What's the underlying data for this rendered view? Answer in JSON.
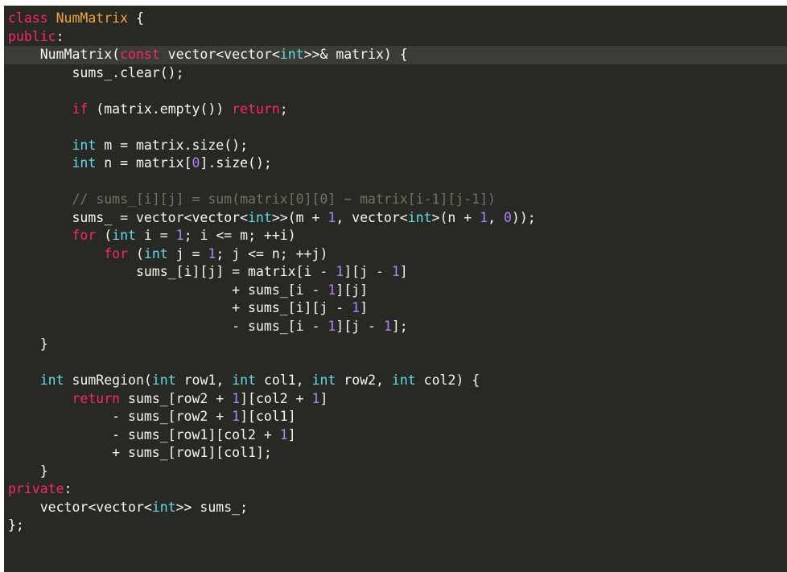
{
  "editor": {
    "language": "cpp",
    "theme": "monokai-dark",
    "background_color": "#282923",
    "highlight_line_color": "#3b3c36",
    "plain_text_color": "#f8f8f2",
    "keyword_color": "#f92672",
    "type_color": "#66d9ef",
    "class_name_color": "#f6a23b",
    "number_color": "#ae81ff",
    "comment_color": "#6f7266",
    "highlighted_line_number": 3,
    "total_lines": 31
  },
  "code": {
    "full_text": "class NumMatrix {\npublic:\n    NumMatrix(const vector<vector<int>>& matrix) {\n        sums_.clear();\n\n        if (matrix.empty()) return;\n\n        int m = matrix.size();\n        int n = matrix[0].size();\n\n        // sums_[i][j] = sum(matrix[0][0] ~ matrix[i-1][j-1])\n        sums_ = vector<vector<int>>(m + 1, vector<int>(n + 1, 0));\n        for (int i = 1; i <= m; ++i)\n            for (int j = 1; j <= n; ++j)\n                sums_[i][j] = matrix[i - 1][j - 1]\n                            + sums_[i - 1][j]\n                            + sums_[i][j - 1]\n                            - sums_[i - 1][j - 1];\n    }\n\n    int sumRegion(int row1, int col1, int row2, int col2) {\n        return sums_[row2 + 1][col2 + 1]\n             - sums_[row2 + 1][col1]\n             - sums_[row1][col2 + 1]\n             + sums_[row1][col1];\n    }\nprivate:\n    vector<vector<int>> sums_;\n};",
    "lines": [
      {
        "n": 1,
        "highlight": false,
        "tokens": [
          {
            "t": "class",
            "c": "kw"
          },
          {
            "t": " ",
            "c": "plain"
          },
          {
            "t": "NumMatrix",
            "c": "clsname"
          },
          {
            "t": " {",
            "c": "plain"
          }
        ]
      },
      {
        "n": 2,
        "highlight": false,
        "tokens": [
          {
            "t": "public",
            "c": "kw"
          },
          {
            "t": ":",
            "c": "plain"
          }
        ]
      },
      {
        "n": 3,
        "highlight": true,
        "tokens": [
          {
            "t": "    NumMatrix(",
            "c": "plain"
          },
          {
            "t": "const",
            "c": "kw"
          },
          {
            "t": " vector<vector<",
            "c": "plain"
          },
          {
            "t": "int",
            "c": "type"
          },
          {
            "t": ">>& matrix) {",
            "c": "plain"
          }
        ]
      },
      {
        "n": 4,
        "highlight": false,
        "tokens": [
          {
            "t": "        sums_.clear();",
            "c": "plain"
          }
        ]
      },
      {
        "n": 5,
        "highlight": false,
        "tokens": [
          {
            "t": "",
            "c": "plain"
          }
        ]
      },
      {
        "n": 6,
        "highlight": false,
        "tokens": [
          {
            "t": "        ",
            "c": "plain"
          },
          {
            "t": "if",
            "c": "kw"
          },
          {
            "t": " (matrix.empty()) ",
            "c": "plain"
          },
          {
            "t": "return",
            "c": "kw"
          },
          {
            "t": ";",
            "c": "plain"
          }
        ]
      },
      {
        "n": 7,
        "highlight": false,
        "tokens": [
          {
            "t": "",
            "c": "plain"
          }
        ]
      },
      {
        "n": 8,
        "highlight": false,
        "tokens": [
          {
            "t": "        ",
            "c": "plain"
          },
          {
            "t": "int",
            "c": "type"
          },
          {
            "t": " m = matrix.size();",
            "c": "plain"
          }
        ]
      },
      {
        "n": 9,
        "highlight": false,
        "tokens": [
          {
            "t": "        ",
            "c": "plain"
          },
          {
            "t": "int",
            "c": "type"
          },
          {
            "t": " n = matrix[",
            "c": "plain"
          },
          {
            "t": "0",
            "c": "num"
          },
          {
            "t": "].size();",
            "c": "plain"
          }
        ]
      },
      {
        "n": 10,
        "highlight": false,
        "tokens": [
          {
            "t": "",
            "c": "plain"
          }
        ]
      },
      {
        "n": 11,
        "highlight": false,
        "tokens": [
          {
            "t": "        ",
            "c": "plain"
          },
          {
            "t": "// sums_[i][j] = sum(matrix[0][0] ~ matrix[i-1][j-1])",
            "c": "comment"
          }
        ]
      },
      {
        "n": 12,
        "highlight": false,
        "tokens": [
          {
            "t": "        sums_ = vector<vector<",
            "c": "plain"
          },
          {
            "t": "int",
            "c": "type"
          },
          {
            "t": ">>(m + ",
            "c": "plain"
          },
          {
            "t": "1",
            "c": "num"
          },
          {
            "t": ", vector<",
            "c": "plain"
          },
          {
            "t": "int",
            "c": "type"
          },
          {
            "t": ">(n + ",
            "c": "plain"
          },
          {
            "t": "1",
            "c": "num"
          },
          {
            "t": ", ",
            "c": "plain"
          },
          {
            "t": "0",
            "c": "num"
          },
          {
            "t": "));",
            "c": "plain"
          }
        ]
      },
      {
        "n": 13,
        "highlight": false,
        "tokens": [
          {
            "t": "        ",
            "c": "plain"
          },
          {
            "t": "for",
            "c": "kw"
          },
          {
            "t": " (",
            "c": "plain"
          },
          {
            "t": "int",
            "c": "type"
          },
          {
            "t": " i = ",
            "c": "plain"
          },
          {
            "t": "1",
            "c": "num"
          },
          {
            "t": "; i <= m; ++i)",
            "c": "plain"
          }
        ]
      },
      {
        "n": 14,
        "highlight": false,
        "tokens": [
          {
            "t": "            ",
            "c": "plain"
          },
          {
            "t": "for",
            "c": "kw"
          },
          {
            "t": " (",
            "c": "plain"
          },
          {
            "t": "int",
            "c": "type"
          },
          {
            "t": " j = ",
            "c": "plain"
          },
          {
            "t": "1",
            "c": "num"
          },
          {
            "t": "; j <= n; ++j)",
            "c": "plain"
          }
        ]
      },
      {
        "n": 15,
        "highlight": false,
        "tokens": [
          {
            "t": "                sums_[i][j] = matrix[i - ",
            "c": "plain"
          },
          {
            "t": "1",
            "c": "num"
          },
          {
            "t": "][j - ",
            "c": "plain"
          },
          {
            "t": "1",
            "c": "num"
          },
          {
            "t": "]",
            "c": "plain"
          }
        ]
      },
      {
        "n": 16,
        "highlight": false,
        "tokens": [
          {
            "t": "                            + sums_[i - ",
            "c": "plain"
          },
          {
            "t": "1",
            "c": "num"
          },
          {
            "t": "][j]",
            "c": "plain"
          }
        ]
      },
      {
        "n": 17,
        "highlight": false,
        "tokens": [
          {
            "t": "                            + sums_[i][j - ",
            "c": "plain"
          },
          {
            "t": "1",
            "c": "num"
          },
          {
            "t": "]",
            "c": "plain"
          }
        ]
      },
      {
        "n": 18,
        "highlight": false,
        "tokens": [
          {
            "t": "                            - sums_[i - ",
            "c": "plain"
          },
          {
            "t": "1",
            "c": "num"
          },
          {
            "t": "][j - ",
            "c": "plain"
          },
          {
            "t": "1",
            "c": "num"
          },
          {
            "t": "];",
            "c": "plain"
          }
        ]
      },
      {
        "n": 19,
        "highlight": false,
        "tokens": [
          {
            "t": "    }",
            "c": "plain"
          }
        ]
      },
      {
        "n": 20,
        "highlight": false,
        "tokens": [
          {
            "t": "",
            "c": "plain"
          }
        ]
      },
      {
        "n": 21,
        "highlight": false,
        "tokens": [
          {
            "t": "    ",
            "c": "plain"
          },
          {
            "t": "int",
            "c": "type"
          },
          {
            "t": " sumRegion(",
            "c": "plain"
          },
          {
            "t": "int",
            "c": "type"
          },
          {
            "t": " row1, ",
            "c": "plain"
          },
          {
            "t": "int",
            "c": "type"
          },
          {
            "t": " col1, ",
            "c": "plain"
          },
          {
            "t": "int",
            "c": "type"
          },
          {
            "t": " row2, ",
            "c": "plain"
          },
          {
            "t": "int",
            "c": "type"
          },
          {
            "t": " col2) {",
            "c": "plain"
          }
        ]
      },
      {
        "n": 22,
        "highlight": false,
        "tokens": [
          {
            "t": "        ",
            "c": "plain"
          },
          {
            "t": "return",
            "c": "kw"
          },
          {
            "t": " sums_[row2 + ",
            "c": "plain"
          },
          {
            "t": "1",
            "c": "num"
          },
          {
            "t": "][col2 + ",
            "c": "plain"
          },
          {
            "t": "1",
            "c": "num"
          },
          {
            "t": "]",
            "c": "plain"
          }
        ]
      },
      {
        "n": 23,
        "highlight": false,
        "tokens": [
          {
            "t": "             - sums_[row2 + ",
            "c": "plain"
          },
          {
            "t": "1",
            "c": "num"
          },
          {
            "t": "][col1]",
            "c": "plain"
          }
        ]
      },
      {
        "n": 24,
        "highlight": false,
        "tokens": [
          {
            "t": "             - sums_[row1][col2 + ",
            "c": "plain"
          },
          {
            "t": "1",
            "c": "num"
          },
          {
            "t": "]",
            "c": "plain"
          }
        ]
      },
      {
        "n": 25,
        "highlight": false,
        "tokens": [
          {
            "t": "             + sums_[row1][col1];",
            "c": "plain"
          }
        ]
      },
      {
        "n": 26,
        "highlight": false,
        "tokens": [
          {
            "t": "    }",
            "c": "plain"
          }
        ]
      },
      {
        "n": 27,
        "highlight": false,
        "tokens": [
          {
            "t": "private",
            "c": "kw"
          },
          {
            "t": ":",
            "c": "plain"
          }
        ]
      },
      {
        "n": 28,
        "highlight": false,
        "tokens": [
          {
            "t": "    vector<vector<",
            "c": "plain"
          },
          {
            "t": "int",
            "c": "type"
          },
          {
            "t": ">> sums_;",
            "c": "plain"
          }
        ]
      },
      {
        "n": 29,
        "highlight": false,
        "tokens": [
          {
            "t": "};",
            "c": "plain"
          }
        ]
      }
    ]
  }
}
